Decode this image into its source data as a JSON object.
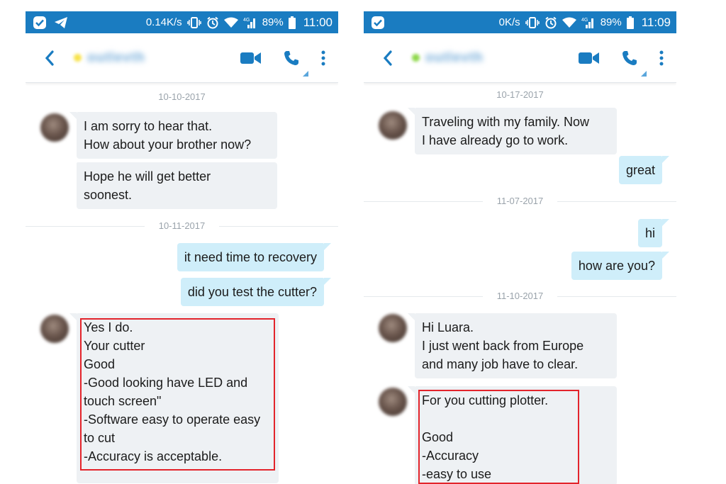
{
  "colors": {
    "skype_blue": "#1a7cc1",
    "incoming_bubble": "#eef1f4",
    "outgoing_bubble": "#cfeefa",
    "highlight_red": "#e3242b"
  },
  "left": {
    "status": {
      "speed": "0.14K/s",
      "battery": "89%",
      "time": "11:00",
      "network": "4G"
    },
    "contact": {
      "name": "outlevth",
      "presence_color": "#f7e24a"
    },
    "dates": [
      "10-10-2017",
      "10-11-2017"
    ],
    "messages": [
      {
        "dir": "in",
        "text": "I am sorry to hear that.\nHow about your brother now?"
      },
      {
        "dir": "in",
        "text": "Hope he will get better\nsoonest."
      },
      {
        "dir": "out",
        "text": "it need time to recovery"
      },
      {
        "dir": "out",
        "text": "did you test the cutter?"
      },
      {
        "dir": "in",
        "text": "Yes I do.\nYour cutter\nGood\n-Good looking have LED and\ntouch screen\"\n-Software easy to operate easy\nto cut\n-Accuracy is acceptable."
      }
    ]
  },
  "right": {
    "status": {
      "speed": "0K/s",
      "battery": "89%",
      "time": "11:09",
      "network": "4G"
    },
    "contact": {
      "name": "outlevth",
      "presence_color": "#8ed84a"
    },
    "dates": [
      "10-17-2017",
      "11-07-2017",
      "11-10-2017"
    ],
    "messages": [
      {
        "dir": "in",
        "text": "Traveling with my family. Now\nI have already  go to work."
      },
      {
        "dir": "out",
        "text": "great"
      },
      {
        "dir": "out",
        "text": "hi"
      },
      {
        "dir": "out",
        "text": "how are you?"
      },
      {
        "dir": "in",
        "text": "Hi Luara.\nI just went back from Europe\nand many job have to clear."
      },
      {
        "dir": "in",
        "text": "For you cutting plotter.\n\nGood\n-Accuracy\n-easy to use"
      }
    ]
  }
}
